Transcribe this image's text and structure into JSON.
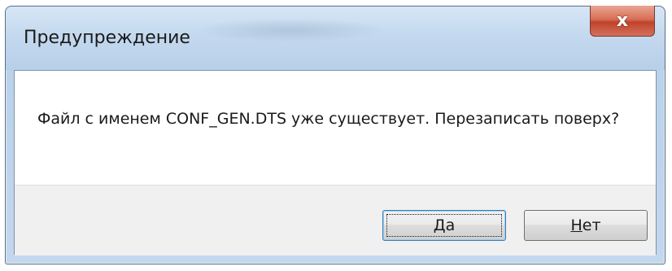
{
  "window": {
    "title": "Предупреждение"
  },
  "titlebar": {
    "close_label": "x"
  },
  "dialog": {
    "message": "Файл с именем CONF_GEN.DTS уже существует. Перезаписать поверх?"
  },
  "buttons": {
    "yes": {
      "accel": "Д",
      "rest": "а"
    },
    "no": {
      "accel": "Н",
      "rest": "ет"
    }
  },
  "icons": {
    "close": "close-icon"
  },
  "colors": {
    "titlebar": "#c4d9ef",
    "close_button": "#c0432b",
    "default_button_border": "#3c7fb1",
    "footer": "#f0f0f0"
  }
}
